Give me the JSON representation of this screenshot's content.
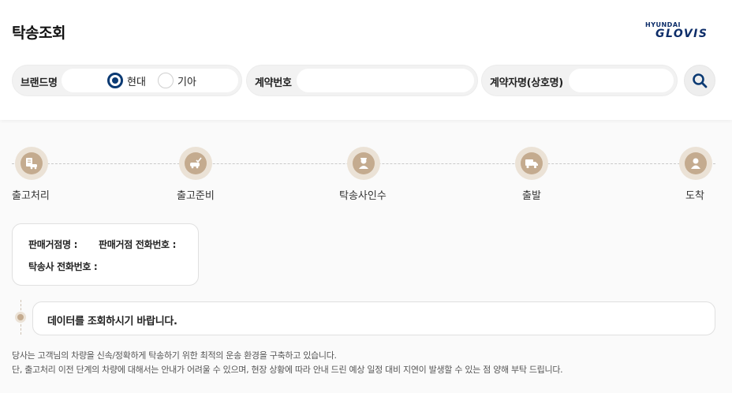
{
  "header": {
    "title": "탁송조회",
    "logo": {
      "line1": "HYUNDAI",
      "line2": "GLOVIS"
    }
  },
  "search": {
    "brand": {
      "label": "브랜드명",
      "options": [
        {
          "label": "현대",
          "selected": true
        },
        {
          "label": "기아",
          "selected": false
        }
      ]
    },
    "contract_no": {
      "label": "계약번호",
      "value": "",
      "placeholder": ""
    },
    "contractor": {
      "label": "계약자명(상호명)",
      "value": "",
      "placeholder": ""
    },
    "search_icon": "search-icon"
  },
  "steps": [
    {
      "label": "출고처리",
      "icon": "document-car-icon"
    },
    {
      "label": "출고준비",
      "icon": "car-check-icon"
    },
    {
      "label": "탁송사인수",
      "icon": "driver-icon"
    },
    {
      "label": "출발",
      "icon": "truck-icon"
    },
    {
      "label": "도착",
      "icon": "person-icon"
    }
  ],
  "info": {
    "dealer_name_label": "판매거점명 :",
    "dealer_phone_label": "판매거점 전화번호 :",
    "carrier_phone_label": "탁송사 전화번호 :"
  },
  "message": "데이터를 조회하시기 바랍니다.",
  "notice": {
    "line1": "당사는 고객님의 차량을 신속/정확하게 탁송하기 위한 최적의 운송 환경을 구축하고 있습니다.",
    "line2": "단, 출고처리 이전 단계의 차량에 대해서는 안내가 어려울 수 있으며, 현장 상황에 따라 안내 드린 예상 일정 대비 지연이 발생할 수 있는 점 양해 부탁 드립니다."
  },
  "colors": {
    "accent": "#0b3a73",
    "step_bg": "#ebe2d6",
    "step_dot": "#c4ab8f"
  }
}
